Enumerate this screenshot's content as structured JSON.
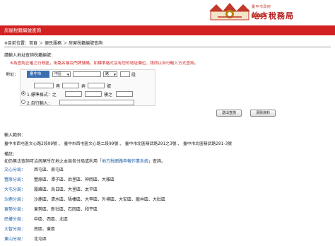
{
  "header": {
    "bureau_small": "臺中市政府",
    "bureau_name": "地方稅務局",
    "bureau_en": "T C L T B"
  },
  "titlebar": {
    "title": "房屋稅籍編號查詢"
  },
  "breadcrumb": {
    "prefix": "※目前位置：",
    "items": [
      "首頁",
      "便民服務",
      "房屋稅籍編號查詢"
    ],
    "separator": "＞"
  },
  "form": {
    "heading": "請輸入地址查詢稅籍編號：",
    "note": "※為查詢正確之行政區，街路名稱及門牌號碼，如標準格式沒有您的地址欄位，請改以自行輸入方式查詢。",
    "address_label": "地址：",
    "city": "臺中市",
    "district": "中區",
    "road_suffix": "路",
    "section_suffix": "段",
    "lane_suffix": "巷",
    "alley_suffix": "弄",
    "number_suffix": "號",
    "opt1_label": "1.標準格式：之",
    "floor_suffix": "樓之",
    "opt2_label": "2.自行輸入：",
    "search_button": "送出查詢",
    "clear_button": "清除資料"
  },
  "examples": {
    "heading": "輸入範例：",
    "line": "臺中市西屯區文心路2段99號 、 臺中市西屯區文心路二段99號 、 臺中市北區精武路291之3號 、 臺中市北區精武路291-3號"
  },
  "remarks": {
    "heading": "備註：",
    "line_before": "如仍無法查詢可洽房屋所在地之本局各分局或利用「",
    "link": "地方稅網路申報作業系統",
    "line_after": "」查詢。"
  },
  "offices": [
    {
      "name": "文心分局：",
      "areas": "西屯區、南屯區"
    },
    {
      "name": "豐原分局：",
      "areas": "豐原區、潭子區、后里區、神岡區、大雅區"
    },
    {
      "name": "大屯分局：",
      "areas": "霧峰區、烏日區、大里區、太平區"
    },
    {
      "name": "沙鹿分局：",
      "areas": "沙鹿區、清水區、梧棲區、大甲區、外埔區、大安區、龍井區、大肚區"
    },
    {
      "name": "東勢分局：",
      "areas": "東勢區、新社區、石岡區、和平區"
    },
    {
      "name": "民權分局：",
      "areas": "中區、西區、北區"
    },
    {
      "name": "大智分局：",
      "areas": "南區、東區"
    },
    {
      "name": "東山分局：",
      "areas": "北屯區"
    }
  ]
}
